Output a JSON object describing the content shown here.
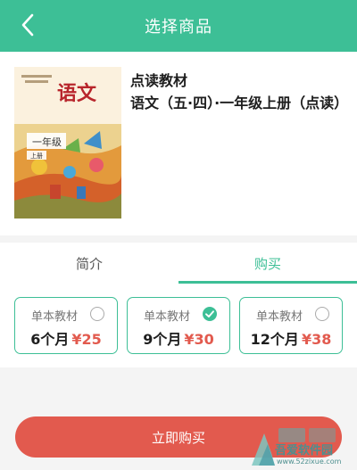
{
  "header": {
    "title": "选择商品"
  },
  "product": {
    "category": "点读教材",
    "title": "语文（五·四）·一年级上册（点读）",
    "cover": {
      "subject": "语文",
      "grade": "一年级",
      "volume": "上册"
    }
  },
  "tabs": {
    "intro": "简介",
    "buy": "购买"
  },
  "plans": [
    {
      "name": "单本教材",
      "duration": "6个月",
      "price": "¥25",
      "selected": false
    },
    {
      "name": "单本教材",
      "duration": "9个月",
      "price": "¥30",
      "selected": true
    },
    {
      "name": "单本教材",
      "duration": "12个月",
      "price": "¥38",
      "selected": false
    }
  ],
  "buy_button": "立即购买",
  "watermark": {
    "name": "吾爱软件园",
    "url": "www.52zixue.com"
  },
  "colors": {
    "accent": "#3dbf96",
    "price": "#e25a4e",
    "buy_button": "#e25a4e"
  }
}
